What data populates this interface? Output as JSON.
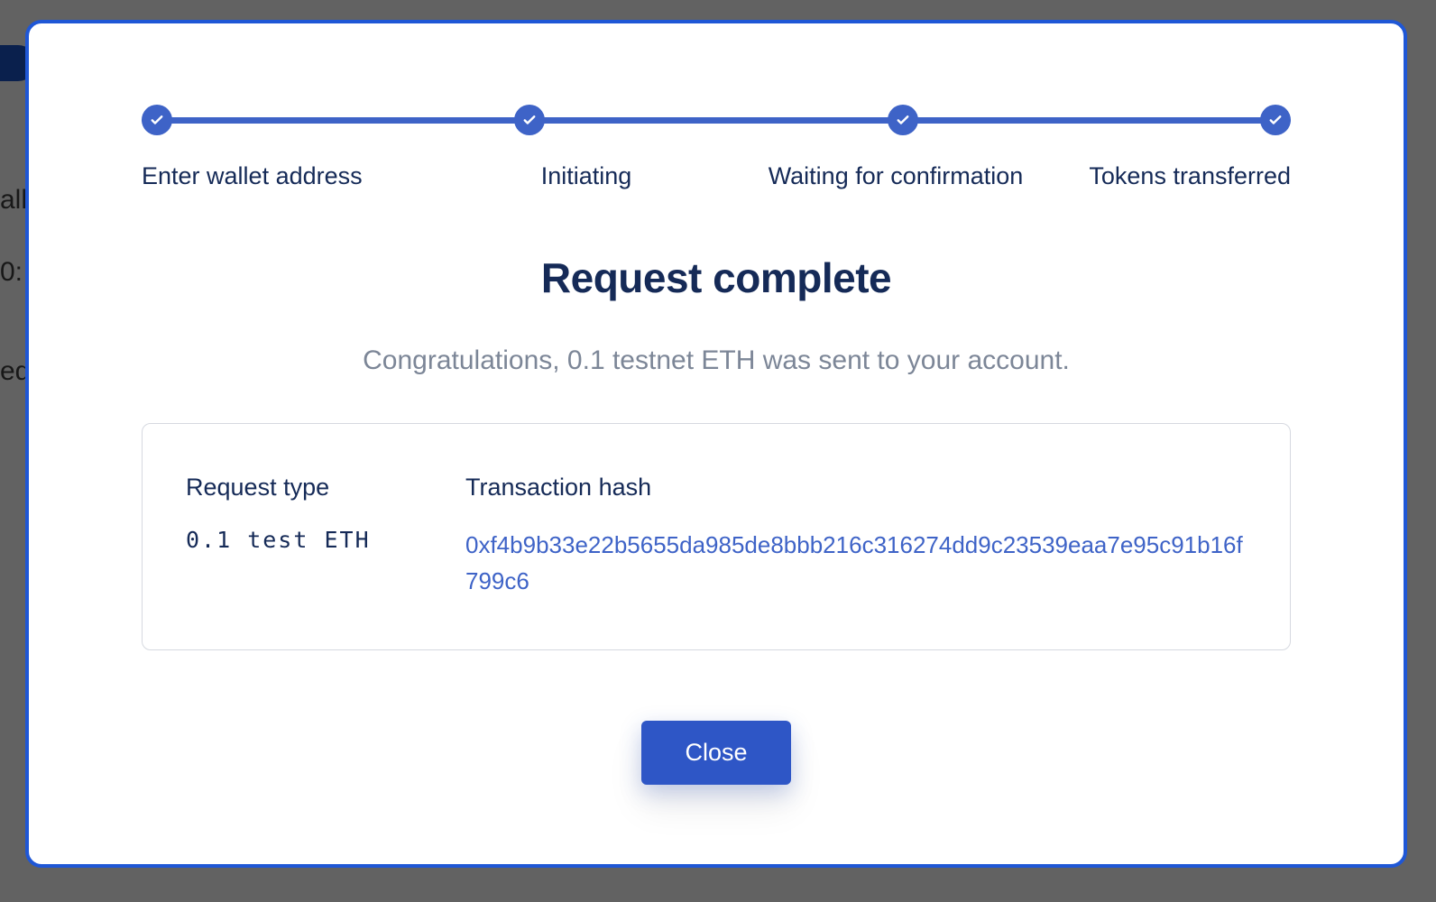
{
  "stepper": {
    "steps": [
      {
        "label": "Enter wallet address",
        "complete": true
      },
      {
        "label": "Initiating",
        "complete": true
      },
      {
        "label": "Waiting for confirmation",
        "complete": true
      },
      {
        "label": "Tokens transferred",
        "complete": true
      }
    ]
  },
  "modal": {
    "title": "Request complete",
    "subtitle": "Congratulations, 0.1 testnet ETH was sent to your account.",
    "close_label": "Close"
  },
  "details": {
    "request_type_label": "Request type",
    "request_type_value": "0.1 test ETH",
    "tx_hash_label": "Transaction hash",
    "tx_hash_value": "0xf4b9b33e22b5655da985de8bbb216c316274dd9c23539eaa7e95c91b16f799c6"
  },
  "background_hints": {
    "row1": "all",
    "row2": "0:",
    "row3": "equ"
  },
  "colors": {
    "accent": "#3e63c7",
    "button": "#2e56c6",
    "text_dark": "#152a57",
    "text_muted": "#7c8697",
    "border": "#d6d9e0",
    "modal_border": "#1f57d6"
  }
}
